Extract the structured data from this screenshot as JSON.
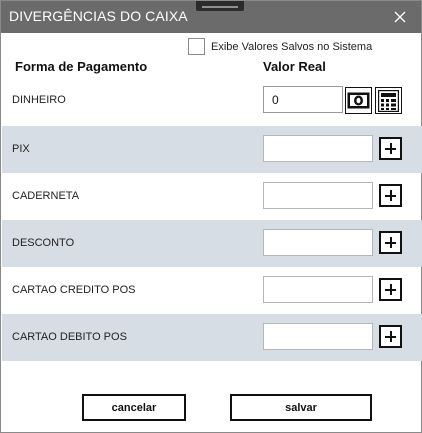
{
  "window": {
    "title": "DIVERGÊNCIAS DO CAIXA",
    "title_bar_color": "#6b6b6b"
  },
  "options": {
    "show_saved_values_label": "Exibe Valores Salvos no Sistema",
    "show_saved_values_checked": false
  },
  "table": {
    "col_payment": "Forma de Pagamento",
    "col_value": "Valor Real",
    "row_alt_color": "#d6dde4",
    "rows": [
      {
        "label": "DINHEIRO",
        "value": ""
      },
      {
        "label": "PIX",
        "value": ""
      },
      {
        "label": "CADERNETA",
        "value": ""
      },
      {
        "label": "DESCONTO",
        "value": ""
      },
      {
        "label": "CARTAO CREDITO POS",
        "value": ""
      },
      {
        "label": "CARTAO DEBITO POS",
        "value": ""
      }
    ],
    "cash_value": "0"
  },
  "actions": {
    "cancel_label": "cancelar",
    "save_label": "salvar"
  },
  "icons": {
    "close": "close-icon",
    "cash": "banknote-icon",
    "calculator": "calculator-icon",
    "add": "plus-icon"
  }
}
